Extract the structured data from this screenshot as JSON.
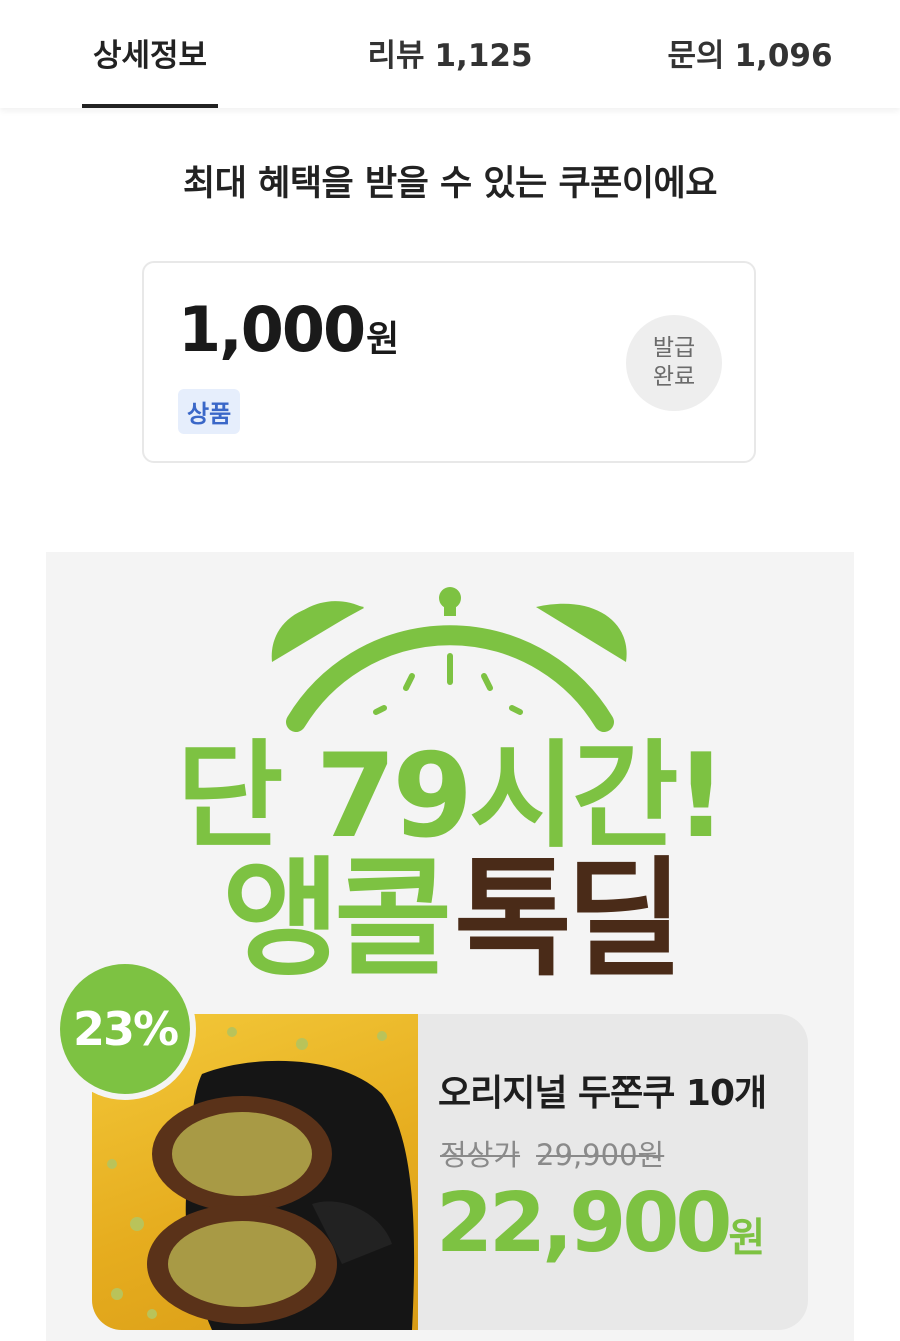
{
  "tabs": [
    {
      "label": "상세정보",
      "count": ""
    },
    {
      "label": "리뷰",
      "count": "1,125"
    },
    {
      "label": "문의",
      "count": "1,096"
    }
  ],
  "coupon": {
    "heading": "최대 혜택을 받을 수 있는 쿠폰이에요",
    "amount": "1,000",
    "unit": "원",
    "tag": "상품",
    "button_line1": "발급",
    "button_line2": "완료"
  },
  "promo": {
    "line1": "단 79시간!",
    "line2_green": "앵콜",
    "line2_brown": "톡딜",
    "discount": "23%",
    "product_name": "오리지널 두쫀쿠 10개",
    "original_label": "정상가",
    "original_price": "29,900원",
    "sale_price": "22,900",
    "sale_unit": "원"
  },
  "colors": {
    "accent_green": "#7dc242",
    "brown": "#4a2b18",
    "coupon_tag_bg": "#e6eefc",
    "coupon_tag_text": "#3a67c8"
  }
}
